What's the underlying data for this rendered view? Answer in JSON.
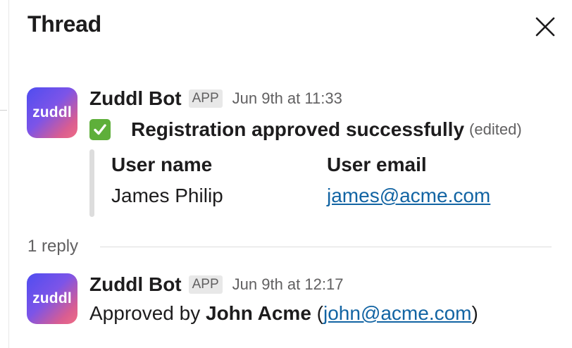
{
  "header": {
    "title": "Thread",
    "close_icon": "close-icon"
  },
  "colors": {
    "link": "#1264a3",
    "check_green": "#5eaf3a",
    "muted_text": "#616061",
    "badge_bg": "#e8e8e8"
  },
  "parent_message": {
    "avatar_text": "zuddl",
    "sender": "Zuddl Bot",
    "badge": "APP",
    "timestamp": "Jun 9th at 11:33",
    "status_icon": "check-mark-icon",
    "status_text": "Registration approved successfully",
    "edited_label": "(edited)",
    "fields": [
      {
        "label": "User name",
        "value": "James Philip"
      },
      {
        "label": "User email",
        "value": "james@acme.com"
      }
    ]
  },
  "replies": {
    "count_label": "1 reply"
  },
  "reply_message": {
    "avatar_text": "zuddl",
    "sender": "Zuddl Bot",
    "badge": "APP",
    "timestamp": "Jun 9th at 12:17",
    "text_prefix": "Approved by ",
    "approver_name": "John Acme",
    "paren_open": " (",
    "approver_email": "john@acme.com",
    "paren_close": ")"
  }
}
